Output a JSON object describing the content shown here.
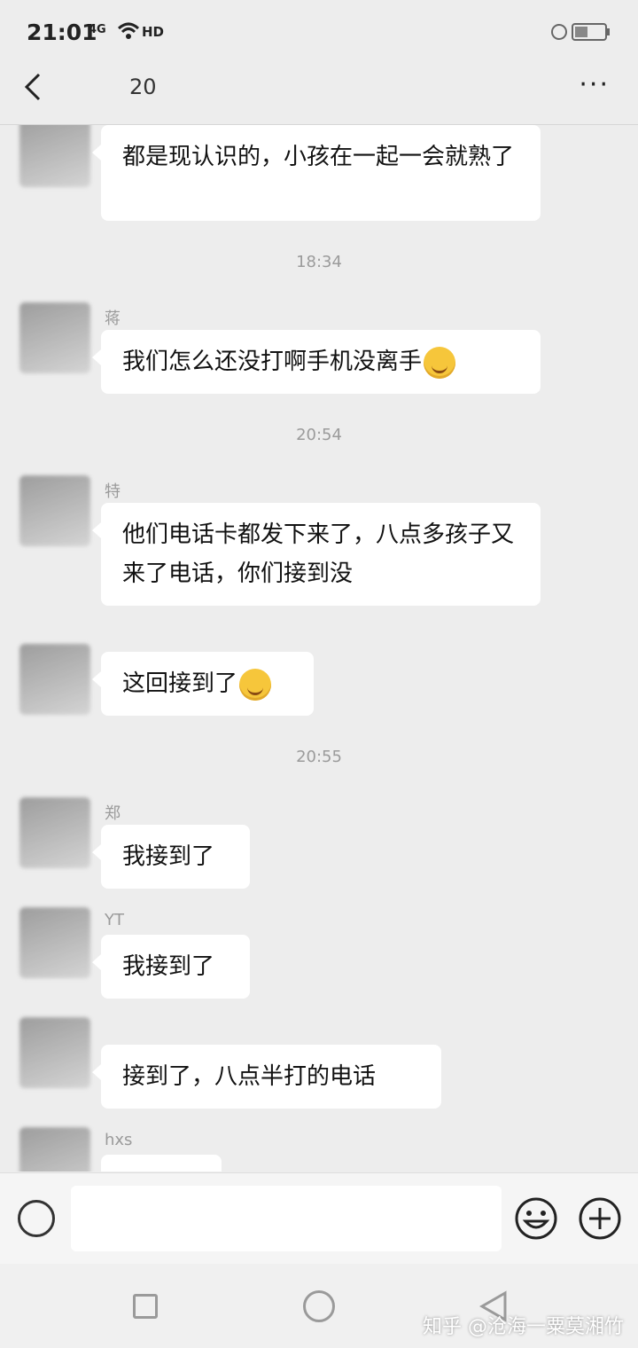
{
  "status_bar": {
    "time": "21:01",
    "signal": "4G",
    "hd": "HD"
  },
  "header": {
    "title": "20",
    "back_icon": "chevron-left-icon",
    "more_label": "···"
  },
  "messages": [
    {
      "type": "text",
      "text": "都是现认识的，小孩在一起一会就熟了"
    },
    {
      "type": "time",
      "text": "18:34"
    },
    {
      "type": "text",
      "sender": "蒋",
      "text": "我们怎么还没打啊手机没离手",
      "emoji": "laugh-cry-emoji"
    },
    {
      "type": "time",
      "text": "20:54"
    },
    {
      "type": "text",
      "sender": "特",
      "text": "他们电话卡都发下来了，八点多孩子又来了电话，你们接到没"
    },
    {
      "type": "text",
      "text": "这回接到了",
      "emoji": "smile-emoji"
    },
    {
      "type": "time",
      "text": "20:55"
    },
    {
      "type": "text",
      "sender": "郑",
      "text": "我接到了"
    },
    {
      "type": "text",
      "sender": "YT",
      "text": "我接到了"
    },
    {
      "type": "text",
      "sender": "",
      "text": "接到了，八点半打的电话"
    },
    {
      "type": "text",
      "sender": "hxs",
      "text": ""
    }
  ],
  "input_bar": {
    "placeholder": ""
  },
  "watermark": "知乎 @沧海一粟莫湘竹"
}
